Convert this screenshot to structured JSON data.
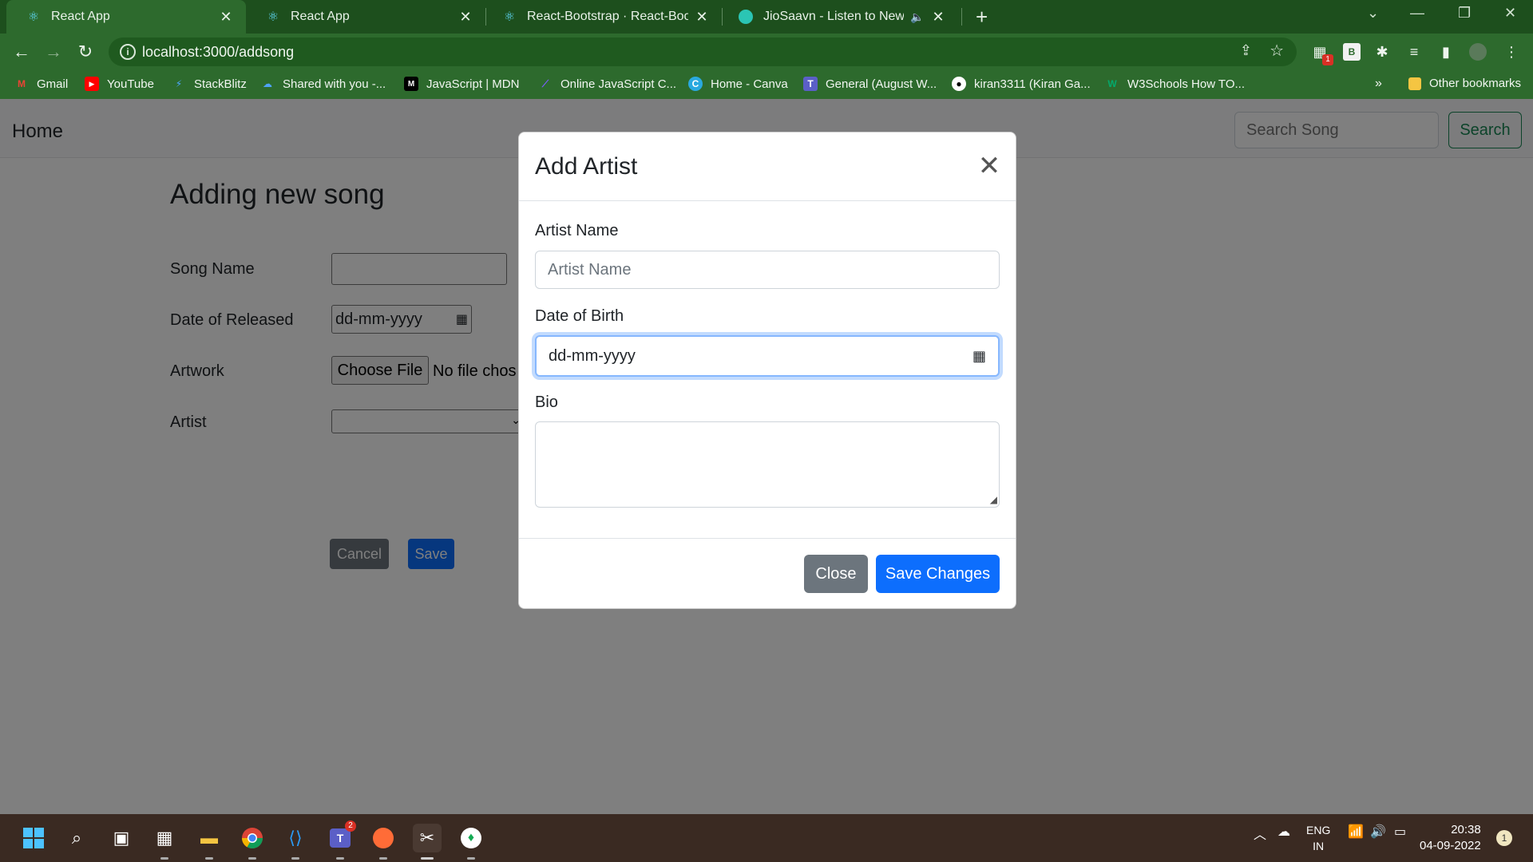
{
  "browser": {
    "tabs": [
      {
        "title": "React App",
        "icon": "react-icon",
        "active": true
      },
      {
        "title": "React App",
        "icon": "react-icon",
        "active": false
      },
      {
        "title": "React-Bootstrap · React-Bootstra",
        "icon": "react-bootstrap-icon",
        "active": false
      },
      {
        "title": "JioSaavn - Listen to New & C",
        "icon": "jiosaavn-icon",
        "active": false
      }
    ],
    "url": "localhost:3000/addsong",
    "bookmarks": [
      {
        "label": "Gmail",
        "icon": "gmail-icon"
      },
      {
        "label": "YouTube",
        "icon": "youtube-icon"
      },
      {
        "label": "StackBlitz",
        "icon": "stackblitz-icon"
      },
      {
        "label": "Shared with you -...",
        "icon": "onedrive-icon"
      },
      {
        "label": "JavaScript | MDN",
        "icon": "mdn-icon"
      },
      {
        "label": "Online JavaScript C...",
        "icon": "code-icon"
      },
      {
        "label": "Home - Canva",
        "icon": "canva-icon"
      },
      {
        "label": "General (August W...",
        "icon": "teams-icon"
      },
      {
        "label": "kiran3311 (Kiran Ga...",
        "icon": "github-icon"
      },
      {
        "label": "W3Schools How TO...",
        "icon": "w3schools-icon"
      }
    ],
    "more_bookmarks": "»",
    "other_bookmarks": "Other bookmarks",
    "extension_badge": "1",
    "b_extension": "B"
  },
  "navbar": {
    "brand": "Home",
    "search_placeholder": "Search Song",
    "search_button": "Search"
  },
  "form": {
    "title": "Adding new song",
    "song_name_label": "Song Name",
    "date_label": "Date of Released",
    "date_placeholder": "dd-mm-yyyy",
    "artwork_label": "Artwork",
    "choose_file": "Choose File",
    "no_file": "No file chos",
    "artist_label": "Artist",
    "cancel": "Cancel",
    "save": "Save"
  },
  "modal": {
    "title": "Add Artist",
    "artist_name_label": "Artist Name",
    "artist_name_placeholder": "Artist Name",
    "dob_label": "Date of Birth",
    "dob_placeholder": "dd-mm-yyyy",
    "bio_label": "Bio",
    "close": "Close",
    "save_changes": "Save Changes"
  },
  "taskbar": {
    "language": "ENG",
    "region": "IN",
    "time": "20:38",
    "date": "04-09-2022",
    "notification_count": "1",
    "teams_badge": "2"
  },
  "colors": {
    "chrome_green": "#2d6a2d",
    "primary": "#0d6efd",
    "secondary": "#6c757d",
    "success": "#198754"
  }
}
